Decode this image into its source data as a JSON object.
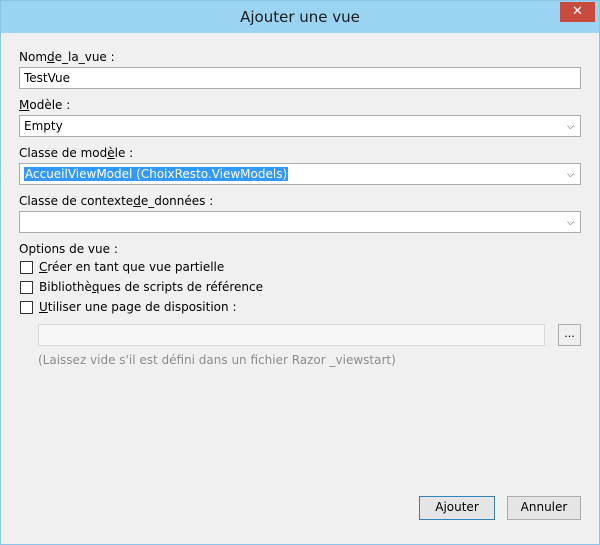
{
  "window": {
    "title": "Ajouter une vue",
    "close_glyph": "✕"
  },
  "fields": {
    "view_name": {
      "label_pre": "Nom",
      "label_u": "d",
      "label_post": "e_la_vue :",
      "value": "TestVue"
    },
    "template": {
      "label_pre": "",
      "label_u": "M",
      "label_post": "odèle :",
      "value": "Empty"
    },
    "model_class": {
      "label_pre": "Classe de mod",
      "label_u": "è",
      "label_post": "le :",
      "value": "AccueilViewModel (ChoixResto.ViewModels)"
    },
    "data_context": {
      "label_pre": "Classe de contexte",
      "label_u": "d",
      "label_post": "e_données :",
      "value": ""
    }
  },
  "options": {
    "heading": "Options de vue :",
    "partial": {
      "label_u": "C",
      "label_rest": "réer en tant que vue partielle",
      "checked": false
    },
    "scripts": {
      "label_pre": "Bibliothè",
      "label_u": "q",
      "label_post": "ues de scripts de référence",
      "checked": false
    },
    "layout": {
      "label_u": "U",
      "label_rest": "tiliser une page de disposition :",
      "checked": false
    },
    "layout_path": "",
    "browse_label": "...",
    "hint": "(Laissez vide s'il est défini dans un fichier Razor _viewstart)"
  },
  "buttons": {
    "add": "Ajouter",
    "cancel": "Annuler"
  },
  "icons": {
    "dropdown": "chevron-down-icon",
    "close": "close-icon"
  },
  "colors": {
    "titlebar": "#9ad4f2",
    "close": "#c74a3c",
    "selection": "#3399ff"
  }
}
